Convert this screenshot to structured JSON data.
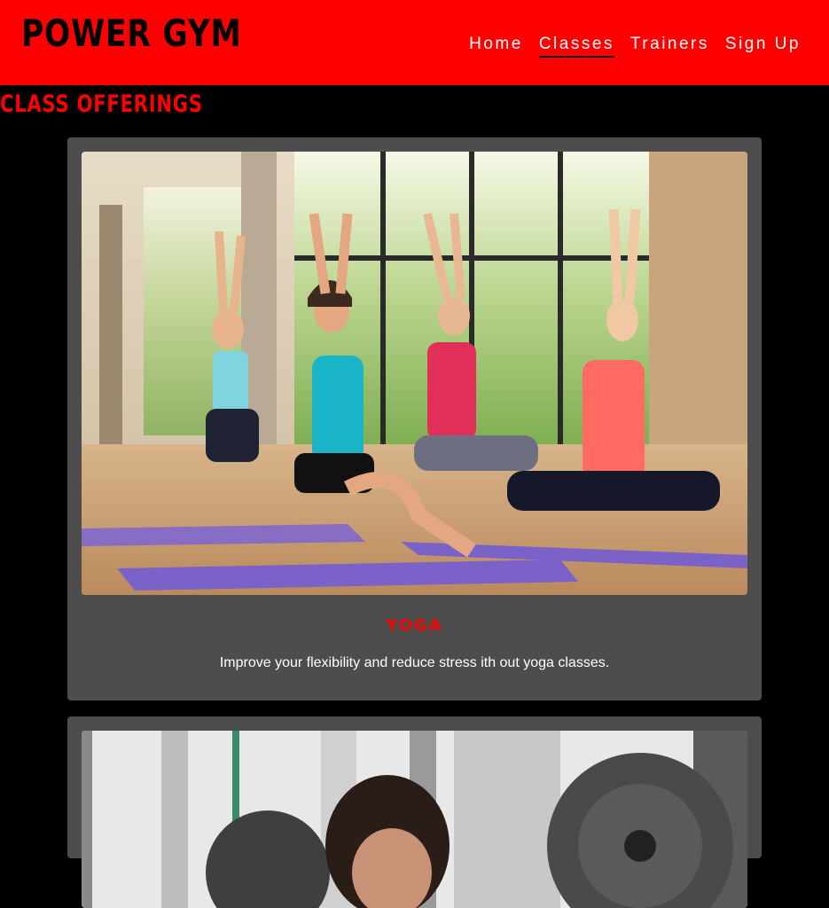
{
  "header": {
    "brand": "POWER GYM",
    "nav": [
      {
        "label": "Home",
        "active": false
      },
      {
        "label": "Classes",
        "active": true
      },
      {
        "label": "Trainers",
        "active": false
      },
      {
        "label": "Sign Up",
        "active": false
      }
    ]
  },
  "section": {
    "title": "CLASS OFFERINGS"
  },
  "classes": [
    {
      "title": "YOGA",
      "description": "Improve your flexibility and reduce stress ith out yoga classes.",
      "image": "yoga-class-photo"
    },
    {
      "title": "",
      "description": "",
      "image": "weightlifting-photo"
    }
  ],
  "colors": {
    "accent": "#ff0000",
    "background": "#000000",
    "card": "#4d4d4d"
  }
}
